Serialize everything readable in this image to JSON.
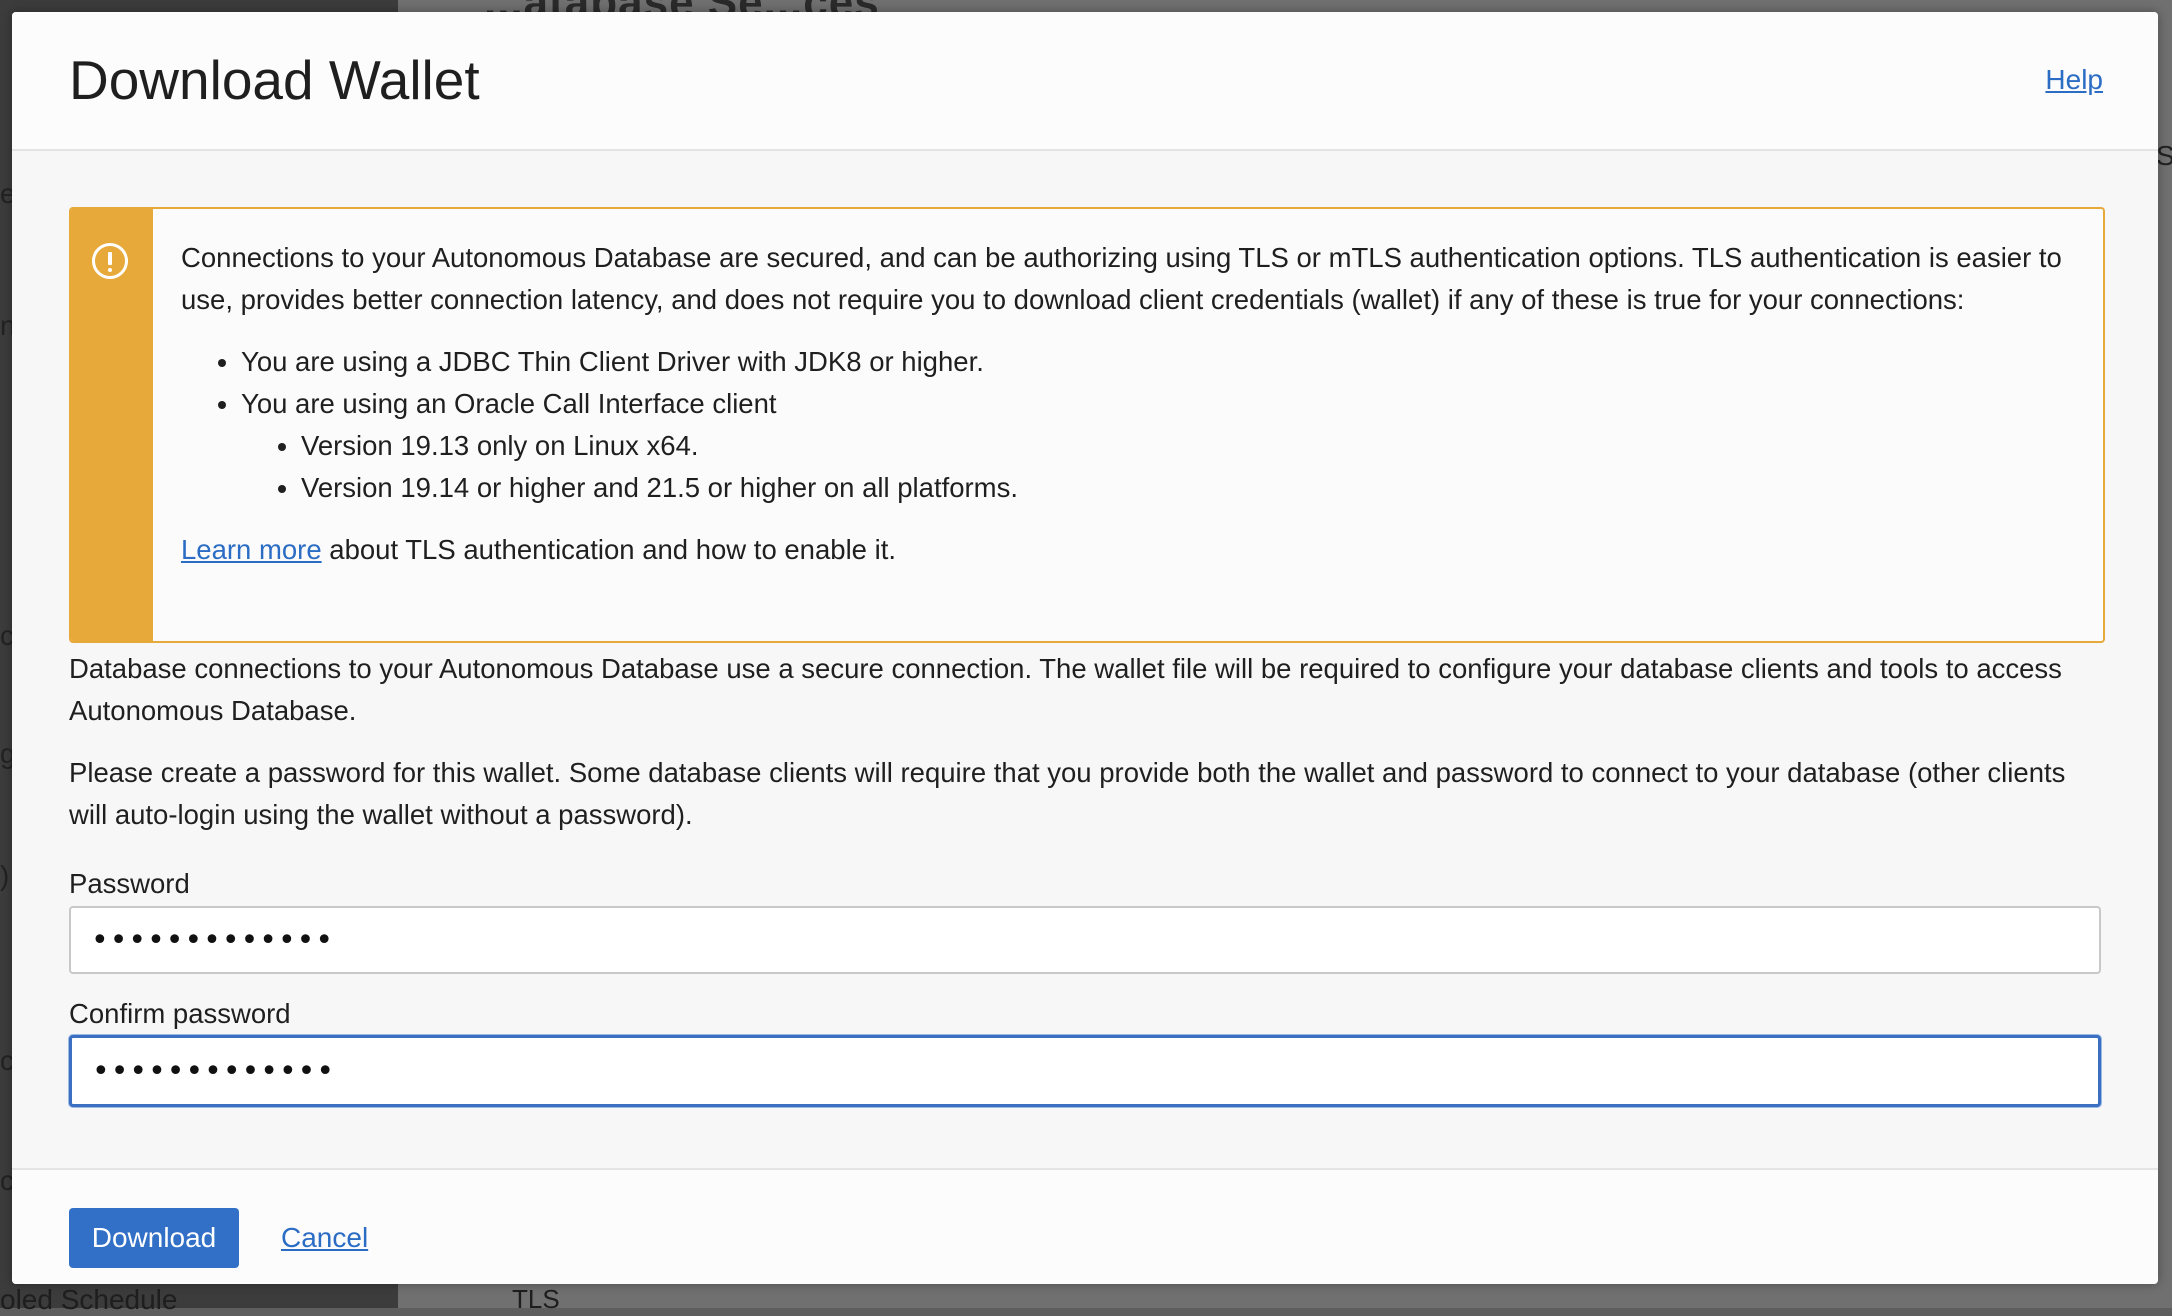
{
  "background": {
    "header_fragment": "...atabase Se...ces",
    "left_fragments": [
      "e",
      "n",
      "c",
      "g",
      ")",
      "c",
      "c"
    ],
    "bottom_left": "oled Schedule",
    "bottom_mid": "TLS",
    "right_fragment": "S"
  },
  "dialog": {
    "title": "Download Wallet",
    "help_label": "Help"
  },
  "warning": {
    "icon": "exclamation-circle-icon",
    "intro": "Connections to your Autonomous Database are secured, and can be authorizing using TLS or mTLS authentication options. TLS authentication is easier to use, provides better connection latency, and does not require you to download client credentials (wallet) if any of these is true for your connections:",
    "bullets": [
      "You are using a JDBC Thin Client Driver with JDK8 or higher.",
      "You are using an Oracle Call Interface client"
    ],
    "sub_bullets": [
      "Version 19.13 only on Linux x64.",
      "Version 19.14 or higher and 21.5 or higher on all platforms."
    ],
    "learn_more_link": "Learn more",
    "learn_more_suffix": " about TLS authentication and how to enable it."
  },
  "body": {
    "paragraph1": "Database connections to your Autonomous Database use a secure connection. The wallet file will be required to configure your database clients and tools to access Autonomous Database.",
    "paragraph2": "Please create a password for this wallet. Some database clients will require that you provide both the wallet and password to connect to your database (other clients will auto-login using the wallet without a password)."
  },
  "form": {
    "password_label": "Password",
    "password_value": "•••••••••••••",
    "confirm_label": "Confirm password",
    "confirm_value": "•••••••••••••"
  },
  "footer": {
    "download_label": "Download",
    "cancel_label": "Cancel"
  },
  "colors": {
    "accent": "#3170c6",
    "warning": "#e8a93b",
    "link": "#2b6cc4"
  }
}
